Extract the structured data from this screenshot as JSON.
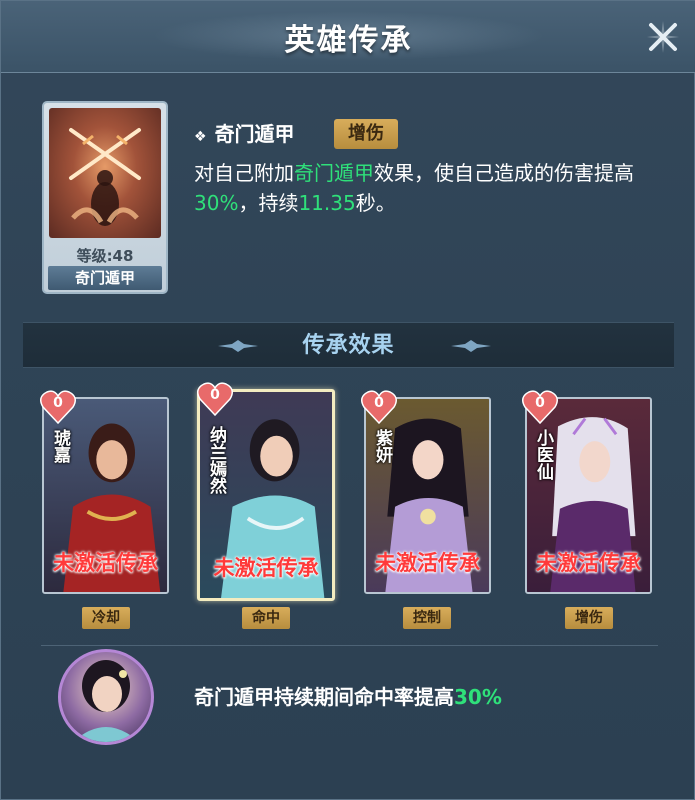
{
  "header": {
    "title": "英雄传承"
  },
  "skill": {
    "level_label": "等级:48",
    "card_name": "奇门遁甲",
    "name": "奇门遁甲",
    "tag": "增伤",
    "desc_part1": "对自己附加",
    "desc_highlight1": "奇门遁甲",
    "desc_part2": "效果，使自己造成的伤害提高",
    "desc_highlight2": "30%",
    "desc_part3": "，持续",
    "desc_highlight3": "11.35",
    "desc_part4": "秒。"
  },
  "section": {
    "title": "传承效果"
  },
  "heroes": [
    {
      "name": "琥嘉",
      "count": "0",
      "status": "未激活传承",
      "tag": "冷却"
    },
    {
      "name": "纳兰嫣然",
      "count": "0",
      "status": "未激活传承",
      "tag": "命中"
    },
    {
      "name": "紫妍",
      "count": "0",
      "status": "未激活传承",
      "tag": "控制"
    },
    {
      "name": "小医仙",
      "count": "0",
      "status": "未激活传承",
      "tag": "增伤"
    }
  ],
  "bonus": {
    "text": "奇门遁甲持续期间命中率提高",
    "value": "30%"
  },
  "colors": {
    "highlight_green": "#2fe07a",
    "inactive_red": "#ff3a3a",
    "tag_gold": "#d8ad5b",
    "section_title": "#a8d3f0"
  },
  "icons": {
    "close": "close-icon",
    "heart": "heart-icon",
    "skill": "crossed-swords-icon"
  }
}
